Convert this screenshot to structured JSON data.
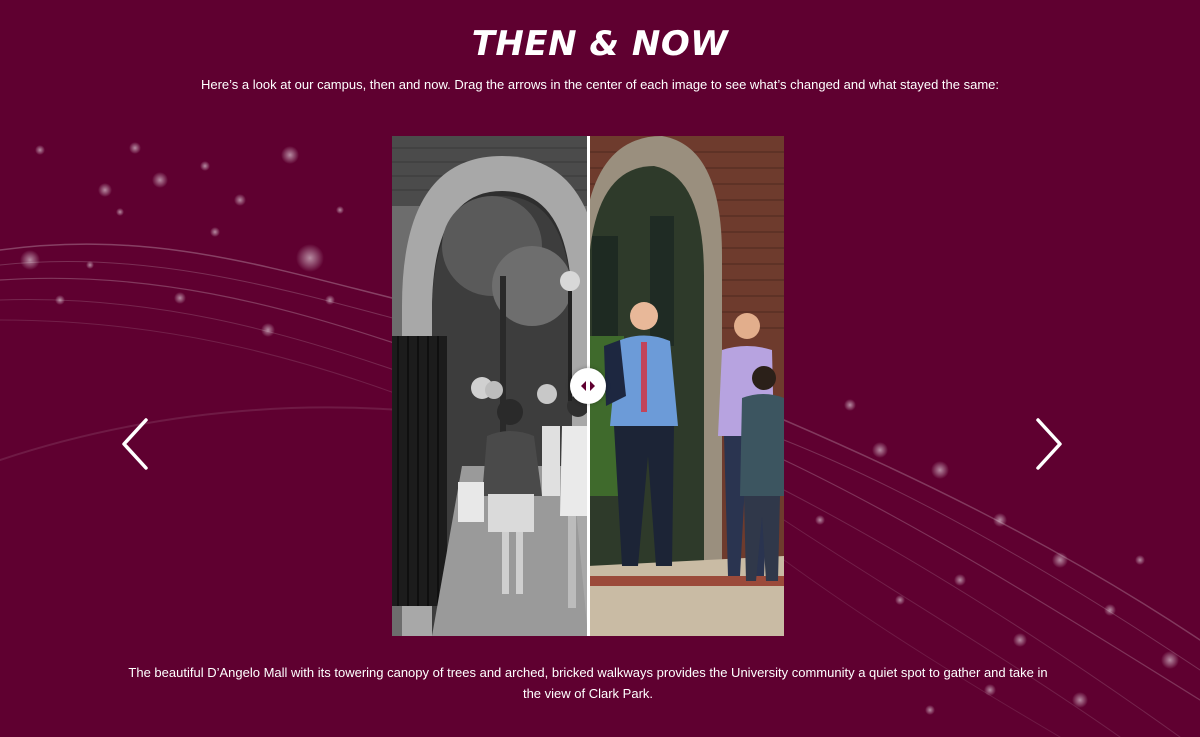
{
  "header": {
    "title": "THEN & NOW",
    "intro": "Here’s a look at our campus, then and now. Drag the arrows in the center of each image to see what’s changed and what stayed the same:"
  },
  "slider": {
    "split_fraction": 0.5,
    "then_label": "then photo",
    "now_label": "now photo"
  },
  "navigation": {
    "prev_icon": "chevron-left-icon",
    "next_icon": "chevron-right-icon"
  },
  "caption": "The beautiful D’Angelo Mall with its towering canopy of trees and arched, bricked walkways provides the University community a quiet spot to gather and take in the view of Clark Park.",
  "colors": {
    "background": "#5f0030",
    "text": "#ffffff",
    "accent": "#b0306a"
  }
}
